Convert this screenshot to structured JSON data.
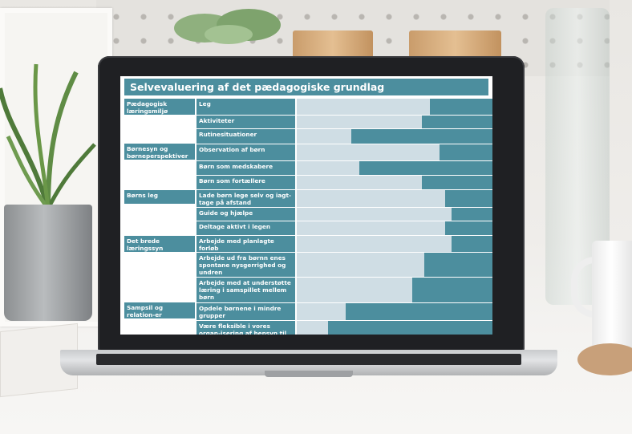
{
  "slide": {
    "title": "Selvevaluering af det pædagogiske grundlag",
    "categories": [
      {
        "id": "c0",
        "label": "Pædagogisk læringsmiljø"
      },
      {
        "id": "c1",
        "label": "Børnesyn og børneperspektiver"
      },
      {
        "id": "c2",
        "label": "Børns leg"
      },
      {
        "id": "c3",
        "label": "Det brede læringssyn"
      },
      {
        "id": "c4",
        "label": "Sampsil og relation-er"
      }
    ],
    "rows": [
      {
        "label": "Leg",
        "level": 0.68
      },
      {
        "label": "Aktiviteter",
        "level": 0.64
      },
      {
        "label": "Rutinesituationer",
        "level": 0.28
      },
      {
        "label": "Observation af børn",
        "level": 0.73
      },
      {
        "label": "Børn som medskabere",
        "level": 0.32
      },
      {
        "label": "Børn som fortællere",
        "level": 0.64
      },
      {
        "label": "Lade børn lege selv og iagt-tage på afstand",
        "level": 0.76
      },
      {
        "label": "Guide og hjælpe",
        "level": 0.79
      },
      {
        "label": "Deltage aktivt i legen",
        "level": 0.76
      },
      {
        "label": "Arbejde med planlagte forløb",
        "level": 0.79
      },
      {
        "label": "Arbejde ud fra børnn enes spontane nysgerrighed og undren",
        "level": 0.65
      },
      {
        "label": "Arbejde med at understøtte læring i samspillet mellem børn",
        "level": 0.59
      },
      {
        "label": "Opdele børnene i mindre grupper",
        "level": 0.25
      },
      {
        "label": "Være fleksible i vores organ-isering af hensyn til børnenes",
        "level": 0.16
      }
    ],
    "colors": {
      "accent": "#4c8e9e",
      "fill": "#cfdde4"
    }
  }
}
